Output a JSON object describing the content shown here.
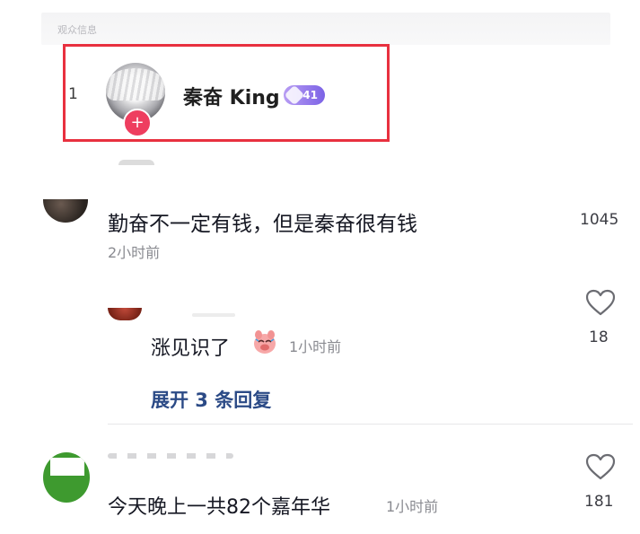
{
  "audience_info": {
    "section_label": "观众信息",
    "rank": "1",
    "username": "秦奋 King",
    "level": "41",
    "follow_symbol": "+"
  },
  "comments": [
    {
      "text": "勤奋不一定有钱，但是秦奋很有钱",
      "time": "2小时前",
      "likes": "1045"
    },
    {
      "text": "今天晚上一共82个嘉年华",
      "time": "1小时前",
      "likes": "181"
    }
  ],
  "reply": {
    "text": "涨见识了",
    "time": "1小时前",
    "likes": "18",
    "emoji_icon": "laughing-pig-emoji"
  },
  "expand_replies_label": "展开 3 条回复",
  "colors": {
    "highlight_border": "#e8303f",
    "follow_badge": "#ee3e5f",
    "level_badge": "#7c63e6",
    "link_text": "#2b4a86",
    "secondary_text": "#8a8b91"
  }
}
